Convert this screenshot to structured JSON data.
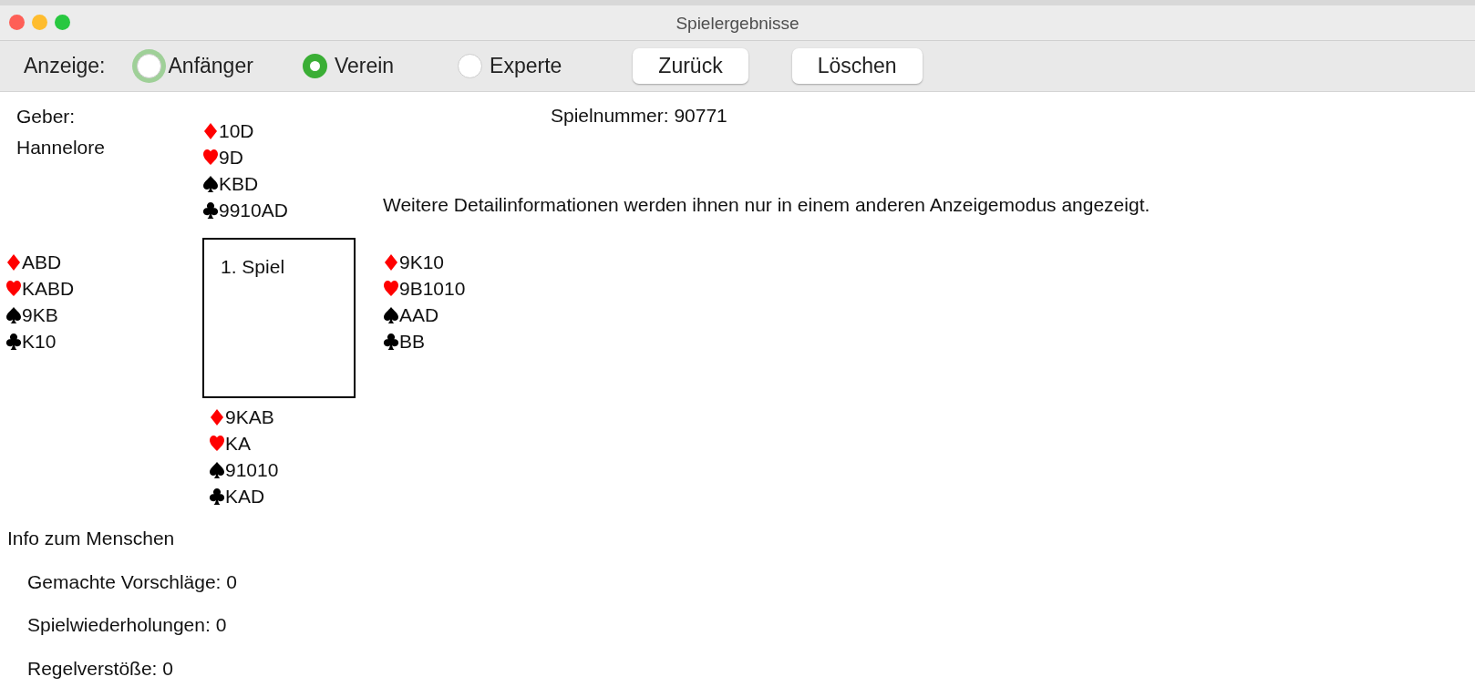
{
  "window": {
    "title": "Spielergebnisse"
  },
  "toolbar": {
    "label": "Anzeige:",
    "options": [
      {
        "label": "Anfänger",
        "selected": false,
        "focused": true
      },
      {
        "label": "Verein",
        "selected": true,
        "focused": false
      },
      {
        "label": "Experte",
        "selected": false,
        "focused": false
      }
    ],
    "buttons": [
      "Zurück",
      "Löschen"
    ]
  },
  "dealer": {
    "label": "Geber:",
    "name": "Hannelore"
  },
  "game_number": "Spielnummer: 90771",
  "notice": "Weitere Detailinformationen werden ihnen nur in einem anderen Anzeigemodus angezeigt.",
  "hands": {
    "north": [
      {
        "kind": "diamonds",
        "cards": "10D"
      },
      {
        "kind": "hearts",
        "cards": "9D"
      },
      {
        "kind": "spades",
        "cards": "KBD"
      },
      {
        "kind": "clubs",
        "cards": "9910AD"
      }
    ],
    "west": [
      {
        "kind": "diamonds",
        "cards": "ABD"
      },
      {
        "kind": "hearts",
        "cards": "KABD"
      },
      {
        "kind": "spades",
        "cards": "9KB"
      },
      {
        "kind": "clubs",
        "cards": "K10"
      }
    ],
    "east": [
      {
        "kind": "diamonds",
        "cards": "9K10"
      },
      {
        "kind": "hearts",
        "cards": "9B1010"
      },
      {
        "kind": "spades",
        "cards": "AAD"
      },
      {
        "kind": "clubs",
        "cards": "BB"
      }
    ],
    "south": [
      {
        "kind": "diamonds",
        "cards": "9KAB"
      },
      {
        "kind": "hearts",
        "cards": "KA"
      },
      {
        "kind": "spades",
        "cards": "91010"
      },
      {
        "kind": "clubs",
        "cards": "KAD"
      }
    ]
  },
  "table_label": "1. Spiel",
  "info": {
    "title": "Info zum Menschen",
    "lines": [
      "Gemachte Vorschläge: 0",
      "Spielwiederholungen: 0",
      "Regelverstöße: 0"
    ]
  }
}
